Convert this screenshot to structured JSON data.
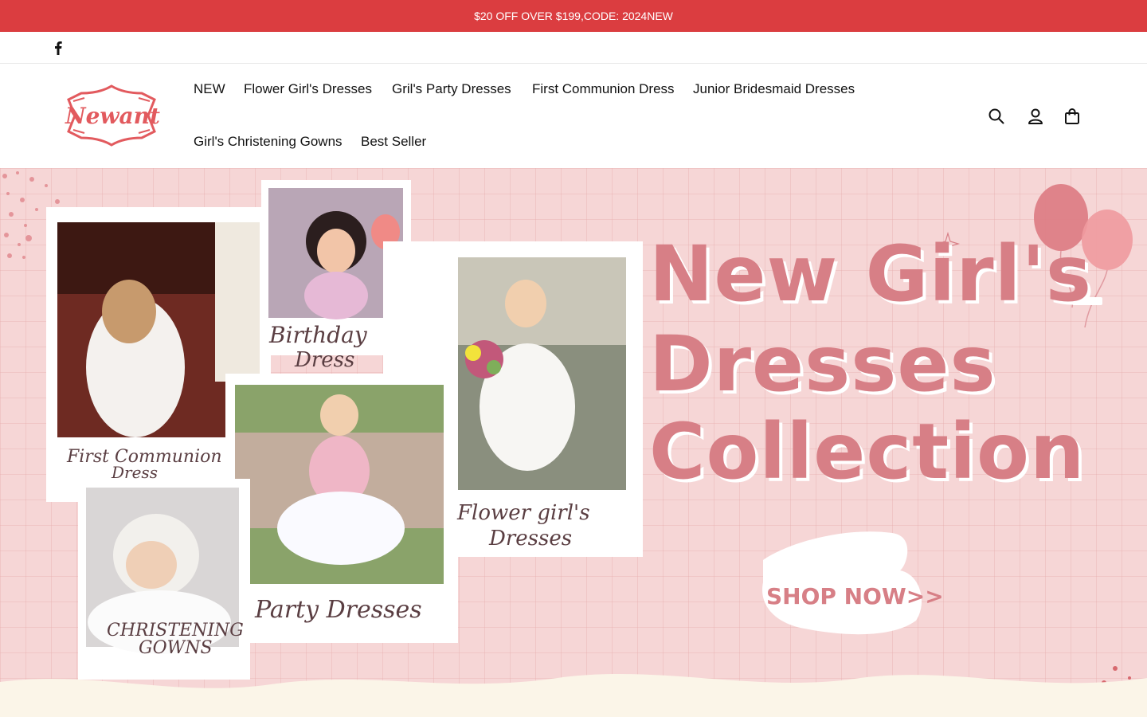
{
  "announcement": {
    "text": "$20 OFF OVER $199,CODE: 2024NEW"
  },
  "social": {
    "facebook_icon": "facebook-icon"
  },
  "header": {
    "logo_text": "Newant",
    "nav": [
      {
        "label": "NEW"
      },
      {
        "label": "Flower Girl's Dresses"
      },
      {
        "label": "Gril's Party Dresses"
      },
      {
        "label": "First Communion Dress"
      },
      {
        "label": "Junior Bridesmaid Dresses"
      },
      {
        "label": "Girl's Christening Gowns"
      },
      {
        "label": "Best Seller"
      }
    ],
    "icons": [
      "search-icon",
      "account-icon",
      "cart-icon"
    ]
  },
  "hero": {
    "headline": [
      "New Girl's",
      "Dresses",
      "Collection"
    ],
    "cta": "SHOP NOW>>",
    "photo_captions": {
      "birthday": [
        "Birthday",
        "Dress"
      ],
      "communion": [
        "First Communion",
        "Dress"
      ],
      "flower": [
        "Flower girl's",
        "Dresses"
      ],
      "party": "Party Dresses",
      "christening": [
        "CHRISTENING",
        "GOWNS"
      ]
    }
  },
  "colors": {
    "accent": "#db3d40",
    "hero_bg": "#f6d6d6",
    "headline": "#d77f86"
  }
}
